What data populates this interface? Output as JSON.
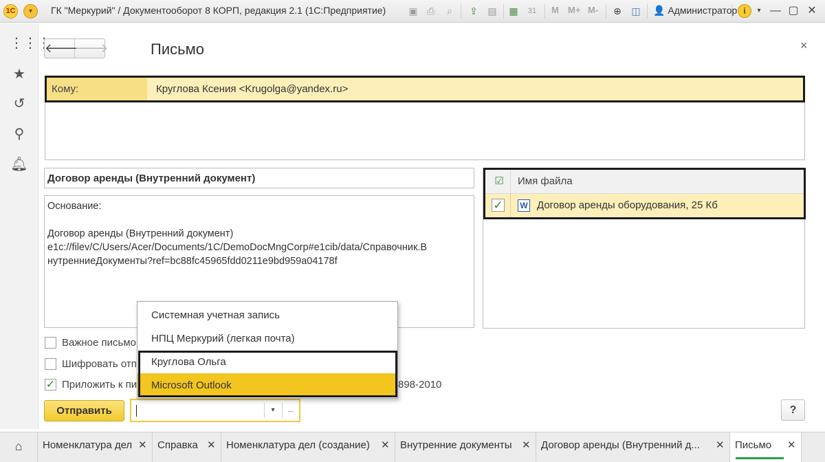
{
  "window": {
    "title": "ГК \"Меркурий\" / Документооборот 8 КОРП, редакция 2.1  (1С:Предприятие)",
    "logo_text": "1С",
    "menu_icon": "chevron-down-icon",
    "toolbar_m_labels": [
      "M",
      "M+",
      "M-"
    ],
    "user": "Администратор",
    "info_label": "i",
    "controls": [
      "minimize-icon",
      "restore-icon",
      "close-icon"
    ]
  },
  "sidebar": {
    "items": [
      "apps-grid-icon",
      "star-icon",
      "history-icon",
      "search-icon",
      "bell-icon"
    ]
  },
  "form": {
    "title": "Письмо",
    "back_glyph": "🡐",
    "forward_glyph": "🡒",
    "close_glyph": "×",
    "to_label": "Кому:",
    "to_value": "Круглова Ксения <Krugolga@yandex.ru>",
    "subject": "Договор аренды (Внутренний документ)",
    "body": [
      "Основание:",
      "",
      "Договор аренды (Внутренний документ)",
      "e1c://filev/C/Users/Acer/Documents/1C/DemoDocMngCorp#e1cib/data/Справочник.В",
      "нутренниеДокументы?ref=bc88fc45965fdd0211e9bd959a04178f"
    ]
  },
  "attachments": {
    "header": "Имя файла",
    "rows": [
      {
        "checked": true,
        "name": "Договор аренды оборудования, 25 Кб"
      }
    ]
  },
  "options": {
    "important": {
      "label": "Важное письмо",
      "checked": false
    },
    "encrypt": {
      "label": "Шифровать отп",
      "checked": false
    },
    "attach": {
      "label": "Приложить к пи",
      "checked": true,
      "tail": "898-2010"
    }
  },
  "send": {
    "label": "Отправить",
    "account_value": "",
    "dropdown_glyph": "▾",
    "more_glyph": "...",
    "help": "?"
  },
  "account_dropdown": {
    "items": [
      "Системная учетная запись",
      "НПЦ Меркурий (легкая почта)",
      "Круглова Ольга",
      "Microsoft Outlook"
    ],
    "selected_index": 3
  },
  "tabs": [
    {
      "label": "Номенклатура дел",
      "active": false
    },
    {
      "label": "Справка",
      "active": false
    },
    {
      "label": "Номенклатура дел (создание)",
      "active": false
    },
    {
      "label": "Внутренние документы",
      "active": false
    },
    {
      "label": "Договор аренды (Внутренний д...",
      "active": false
    },
    {
      "label": "Письмо",
      "active": true
    }
  ],
  "colors": {
    "accent_yellow": "#f2c51f",
    "row_highlight": "#fcefb9",
    "active_tab_underline": "#26a146"
  }
}
